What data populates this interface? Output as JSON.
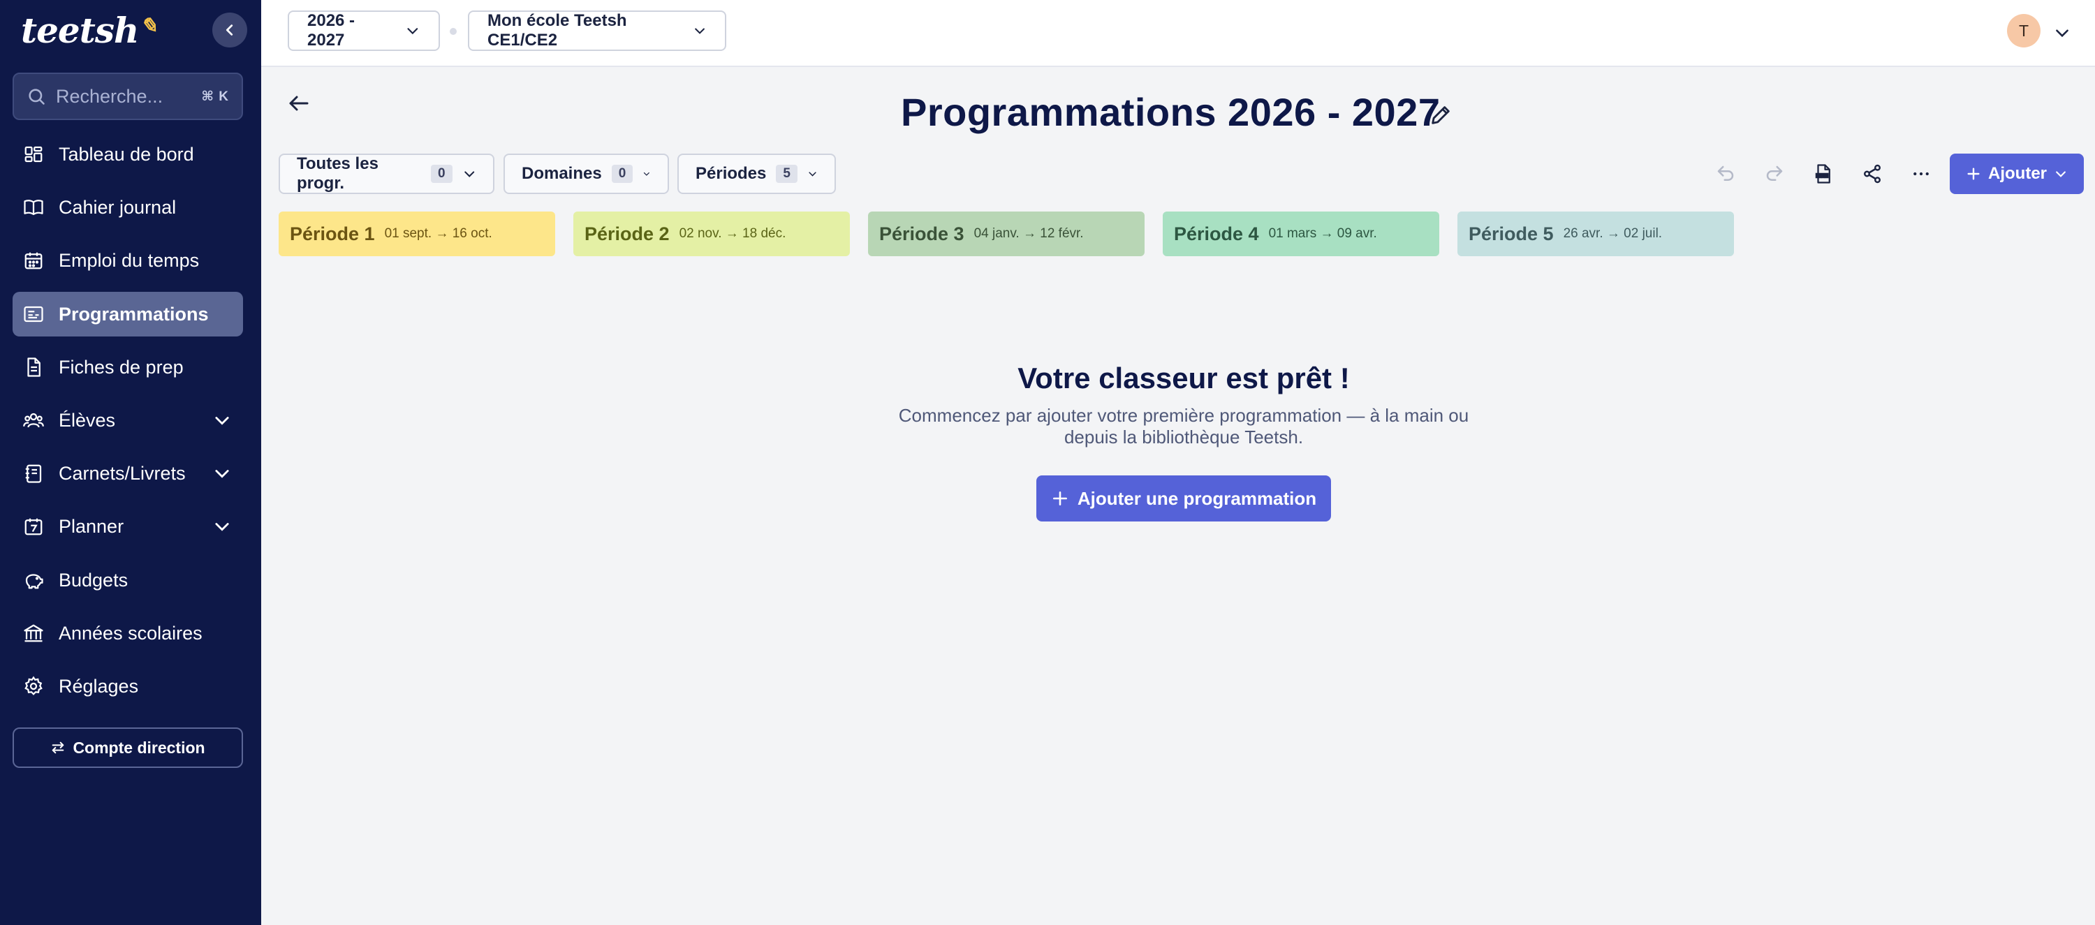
{
  "sidebar": {
    "logo_text": "teetsh",
    "search": {
      "placeholder": "Recherche...",
      "shortcut": "⌘ K"
    },
    "items": [
      {
        "label": "Tableau de bord",
        "icon": "dashboard-icon"
      },
      {
        "label": "Cahier journal",
        "icon": "book-icon"
      },
      {
        "label": "Emploi du temps",
        "icon": "calendar-icon"
      },
      {
        "label": "Programmations",
        "icon": "programmations-icon",
        "active": true
      },
      {
        "label": "Fiches de prep",
        "icon": "document-icon"
      },
      {
        "label": "Élèves",
        "icon": "students-icon",
        "expandable": true
      },
      {
        "label": "Carnets/Livrets",
        "icon": "notebook-icon",
        "expandable": true
      },
      {
        "label": "Planner",
        "icon": "planner-icon",
        "expandable": true
      },
      {
        "label": "Budgets",
        "icon": "piggy-bank-icon"
      },
      {
        "label": "Années scolaires",
        "icon": "school-building-icon"
      },
      {
        "label": "Réglages",
        "icon": "gear-icon"
      }
    ],
    "direction_button": "Compte direction"
  },
  "topbar": {
    "year_select": "2026 - 2027",
    "school_select": "Mon école Teetsh CE1/CE2",
    "avatar_initial": "T"
  },
  "main": {
    "title": "Programmations 2026 - 2027",
    "filters": [
      {
        "label": "Toutes les progr.",
        "count": "0"
      },
      {
        "label": "Domaines",
        "count": "0"
      },
      {
        "label": "Périodes",
        "count": "5"
      }
    ],
    "toolbar": {
      "tools": [
        "undo-icon",
        "redo-icon",
        "pdf-icon",
        "share-icon",
        "more-icon"
      ],
      "add_label": "Ajouter"
    },
    "periods": [
      {
        "name": "Période 1",
        "dates": "01 sept. → 16 oct.",
        "bg": "#fde68a",
        "fg": "#6b5412"
      },
      {
        "name": "Période 2",
        "dates": "02 nov. → 18 déc.",
        "bg": "#e4f0a5",
        "fg": "#5a6416"
      },
      {
        "name": "Période 3",
        "dates": "04 janv. → 12 févr.",
        "bg": "#b8d6b5",
        "fg": "#3a5238"
      },
      {
        "name": "Période 4",
        "dates": "01 mars → 09 avr.",
        "bg": "#a8e0c2",
        "fg": "#2d5742"
      },
      {
        "name": "Période 5",
        "dates": "26 avr. → 02 juil.",
        "bg": "#c4e0e0",
        "fg": "#3f5b5e"
      }
    ],
    "empty_state": {
      "title": "Votre classeur est prêt !",
      "subtitle": "Commencez par ajouter votre première programmation — à la main ou depuis la bibliothèque Teetsh.",
      "cta": "Ajouter une programmation"
    }
  },
  "colors": {
    "sidebar_bg": "#0e1848",
    "accent": "#5562d8",
    "page_bg": "#f3f4f6"
  }
}
